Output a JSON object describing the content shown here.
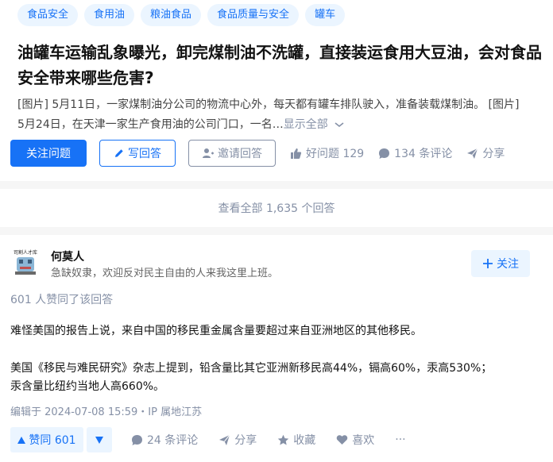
{
  "topics": [
    "食品安全",
    "食用油",
    "粮油食品",
    "食品质量与安全",
    "罐车"
  ],
  "question": {
    "title": "油罐车运输乱象曝光，卸完煤制油不洗罐，直接装运食用大豆油，会对食品安全带来哪些危害?",
    "excerpt_line1": "[图片] 5月11日，一家煤制油分公司的物流中心外，每天都有罐车排队驶入，准备装载煤制油。 [图片]",
    "excerpt_line2": "5月24日，在天津一家生产食用油的公司门口，一名…",
    "show_all": "显示全部"
  },
  "question_actions": {
    "follow": "关注问题",
    "write_answer": "写回答",
    "invite": "邀请回答",
    "good_question": "好问题 129",
    "comments": "134 条评论",
    "share": "分享"
  },
  "view_all": "查看全部 1,635 个回答",
  "answer": {
    "author_name": "何莫人",
    "author_bio": "急缺奴隶，欢迎反对民主自由的人来我这里上班。",
    "avatar_text": "司割人才库",
    "follow": "关注",
    "upvote_summary": "601 人赞同了该回答",
    "paragraph1": "难怪美国的报告上说，来自中国的移民重金属含量要超过来自亚洲地区的其他移民。",
    "paragraph2_line1": "美国《移民与难民研究》杂志上提到，铅含量比其它亚洲新移民高44%，镉高60%，汞高530%；",
    "paragraph2_line2": "汞含量比纽约当地人高660%。",
    "edit_time": "编辑于 2024-07-08 15:59・IP 属地江苏"
  },
  "answer_actions": {
    "upvote": "赞同 601",
    "comments": "24 条评论",
    "share": "分享",
    "collect": "收藏",
    "like": "喜欢",
    "more": "···"
  },
  "colors": {
    "brand_blue": "#1772f6",
    "light_blue_bg": "#ebf5ff",
    "meta_gray": "#8590a6",
    "page_bg": "#f6f6f6"
  }
}
